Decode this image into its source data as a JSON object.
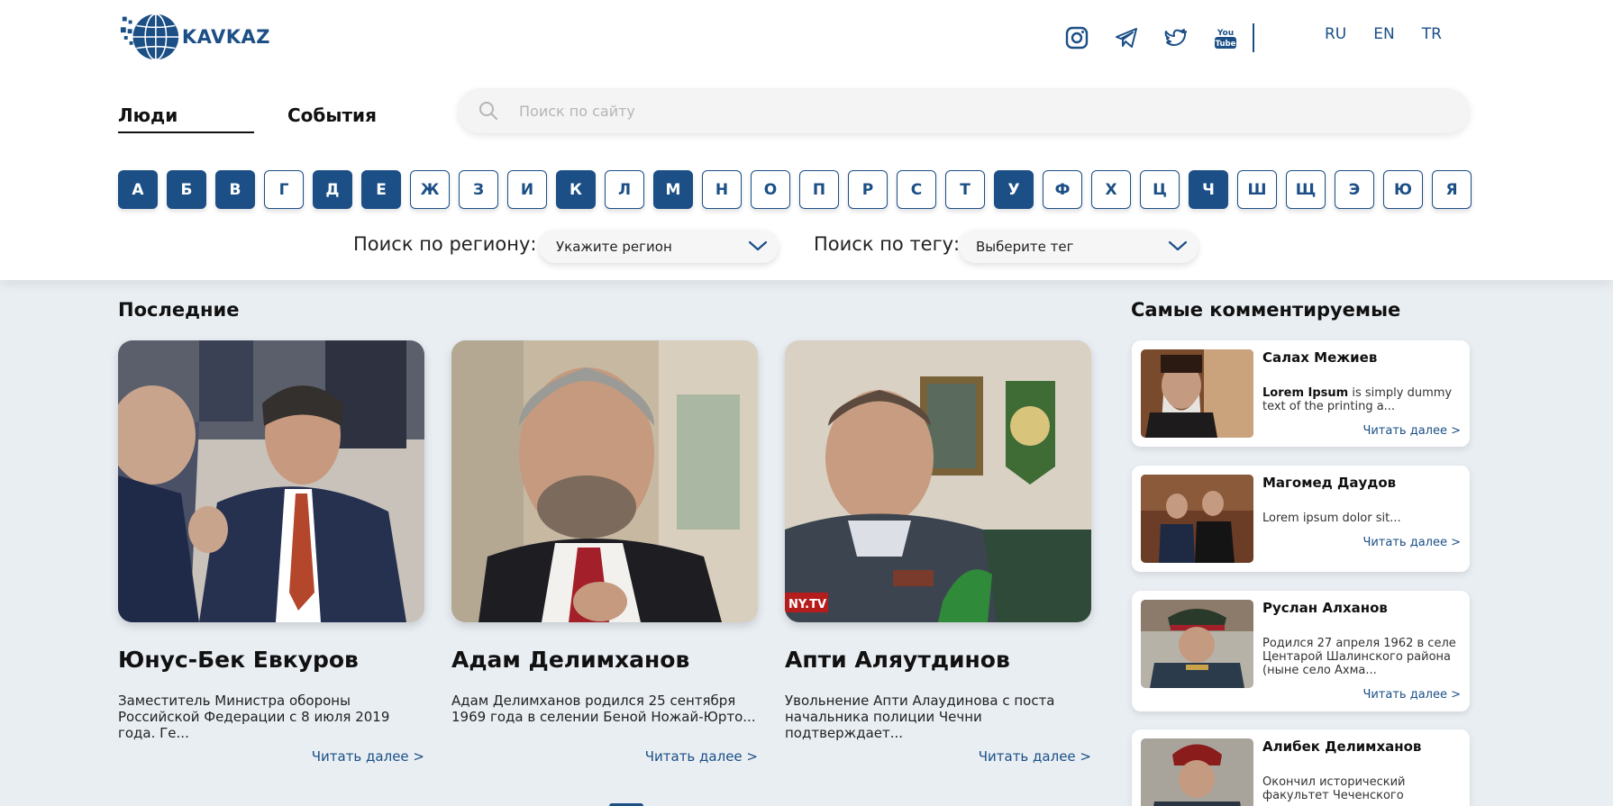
{
  "brand": {
    "logo_text": "KAVKAZ"
  },
  "socials": [
    {
      "icon": "instagram-icon"
    },
    {
      "icon": "telegram-icon"
    },
    {
      "icon": "twitter-icon"
    },
    {
      "icon": "youtube-icon",
      "text_top": "You",
      "text_bottom": "Tube"
    }
  ],
  "languages": [
    "RU",
    "EN",
    "TR"
  ],
  "tabs": {
    "people": "Люди",
    "events": "События"
  },
  "search": {
    "placeholder": "Поиск по сайту"
  },
  "alphabet": [
    {
      "letter": "А",
      "active": true
    },
    {
      "letter": "Б",
      "active": true
    },
    {
      "letter": "В",
      "active": true
    },
    {
      "letter": "Г",
      "active": false
    },
    {
      "letter": "Д",
      "active": true
    },
    {
      "letter": "Е",
      "active": true
    },
    {
      "letter": "Ж",
      "active": false
    },
    {
      "letter": "З",
      "active": false
    },
    {
      "letter": "И",
      "active": false
    },
    {
      "letter": "К",
      "active": true
    },
    {
      "letter": "Л",
      "active": false
    },
    {
      "letter": "М",
      "active": true
    },
    {
      "letter": "Н",
      "active": false
    },
    {
      "letter": "О",
      "active": false
    },
    {
      "letter": "П",
      "active": false
    },
    {
      "letter": "Р",
      "active": false
    },
    {
      "letter": "С",
      "active": false
    },
    {
      "letter": "Т",
      "active": false
    },
    {
      "letter": "У",
      "active": true
    },
    {
      "letter": "Ф",
      "active": false
    },
    {
      "letter": "Х",
      "active": false
    },
    {
      "letter": "Ц",
      "active": false
    },
    {
      "letter": "Ч",
      "active": true
    },
    {
      "letter": "Ш",
      "active": false
    },
    {
      "letter": "Щ",
      "active": false
    },
    {
      "letter": "Э",
      "active": false
    },
    {
      "letter": "Ю",
      "active": false
    },
    {
      "letter": "Я",
      "active": false
    }
  ],
  "filters": {
    "region_label": "Поиск по региону:",
    "region_value": "Укажите регион",
    "tag_label": "Поиск по тегу:",
    "tag_value": "Выберите тег"
  },
  "latest": {
    "title": "Последние",
    "cards": [
      {
        "name": "Юнус-Бек Евкуров",
        "text": "Заместитель Министра обороны Российской Федерации с 8 июля 2019 года. Ге...",
        "more": "Читать далее >"
      },
      {
        "name": "Адам Делимханов",
        "text": "Адам Делимханов родился 25 сентября 1969 года в селении Беной Ножай-Юрто...",
        "more": "Читать далее >"
      },
      {
        "name": "Апти Аляутдинов",
        "text": "Увольнение Апти Алаудинова с поста начальника полиции Чечни подтверждает...",
        "more": "Читать далее >"
      }
    ]
  },
  "commented": {
    "title": "Самые комментируемые",
    "items": [
      {
        "name": "Салах Межиев",
        "text_bold": "Lorem Ipsum",
        "text": " is simply dummy text of the printing a...",
        "more": "Читать далее >"
      },
      {
        "name": "Магомед Даудов",
        "text_bold": "",
        "text": "Lorem ipsum dolor sit...",
        "more": "Читать далее >"
      },
      {
        "name": "Руслан Алханов",
        "text_bold": "",
        "text": "Родился 27 апреля 1962 в селе Центарой Шалинского района (ныне село Ахма...",
        "more": "Читать далее >"
      },
      {
        "name": "Алибек Делимханов",
        "text_bold": "",
        "text": "Окончил исторический факультет Чеченского",
        "more": ""
      }
    ]
  },
  "photo_captions": {
    "tv_logo": "NY.TV"
  },
  "colors": {
    "accent": "#1b4f86",
    "background": "#e9eef3"
  }
}
